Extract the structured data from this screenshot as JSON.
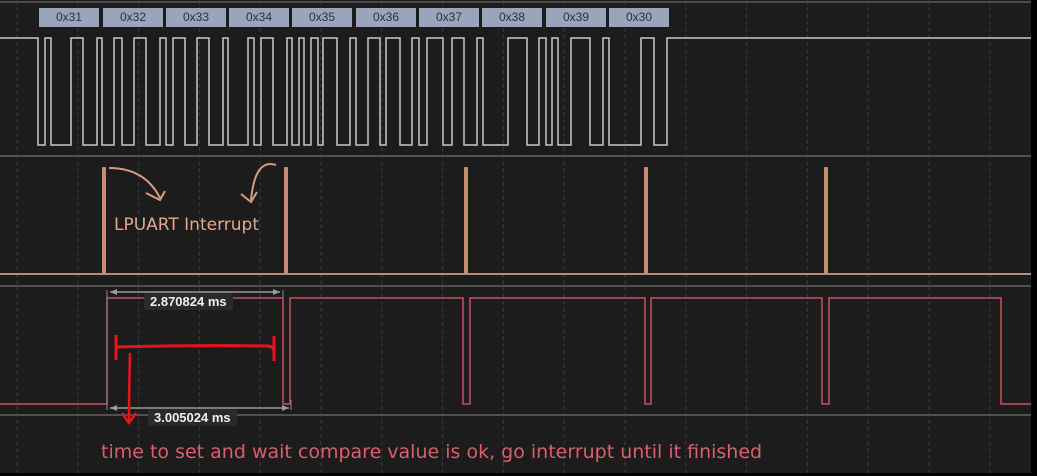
{
  "uart_channel": {
    "decoded_bytes": [
      "0x31",
      "0x32",
      "0x33",
      "0x34",
      "0x35",
      "0x36",
      "0x37",
      "0x38",
      "0x39",
      "0x30"
    ]
  },
  "measurements": {
    "pulse_width": "2.870824 ms",
    "period": "3.005024 ms"
  },
  "annotations": {
    "interrupt_label": "LPUART Interrupt",
    "bottom_note": "time to set and wait compare value is ok, go interrupt until it finished"
  },
  "colors": {
    "background": "#1c1c1c",
    "uart_trace": "#c8c8c8",
    "interrupt_trace": "#d89a7c",
    "pwm_trace": "#c9505f",
    "annotation_red": "#e8141c"
  }
}
